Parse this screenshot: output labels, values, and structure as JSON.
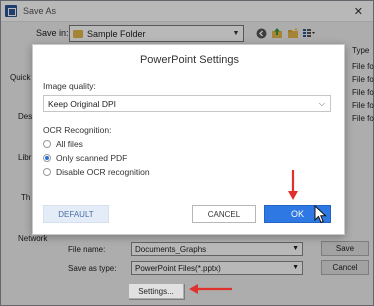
{
  "window": {
    "title": "Save As",
    "close_glyph": "✕"
  },
  "save_in": {
    "label": "Save in:",
    "folder": "Sample Folder"
  },
  "left_nav": {
    "items": [
      "Quick",
      "Des",
      "Libr",
      "Th",
      "Network"
    ]
  },
  "file_list": {
    "header": "Type",
    "items": [
      "File fo",
      "File fo",
      "File fo",
      "File fo",
      "File fo"
    ]
  },
  "filename": {
    "label": "File name:",
    "value": "Documents_Graphs"
  },
  "save_type": {
    "label": "Save as type:",
    "value": "PowerPoint Files(*.pptx)"
  },
  "buttons": {
    "save": "Save",
    "cancel": "Cancel",
    "settings": "Settings..."
  },
  "ppt_settings": {
    "title": "PowerPoint Settings",
    "image_quality_label": "Image quality:",
    "image_quality_value": "Keep Original DPI",
    "ocr_label": "OCR Recognition:",
    "ocr_options": [
      "All files",
      "Only scanned PDF",
      "Disable OCR recognition"
    ],
    "ocr_selected": "Only scanned PDF",
    "default_label": "DEFAULT",
    "cancel_label": "CANCEL",
    "ok_label": "OK"
  },
  "colors": {
    "annotation_arrow": "#e0322c",
    "ok_button": "#2d78e3"
  },
  "icons": [
    "back-icon",
    "up-folder-icon",
    "new-folder-icon",
    "view-menu-icon",
    "cursor-icon"
  ]
}
